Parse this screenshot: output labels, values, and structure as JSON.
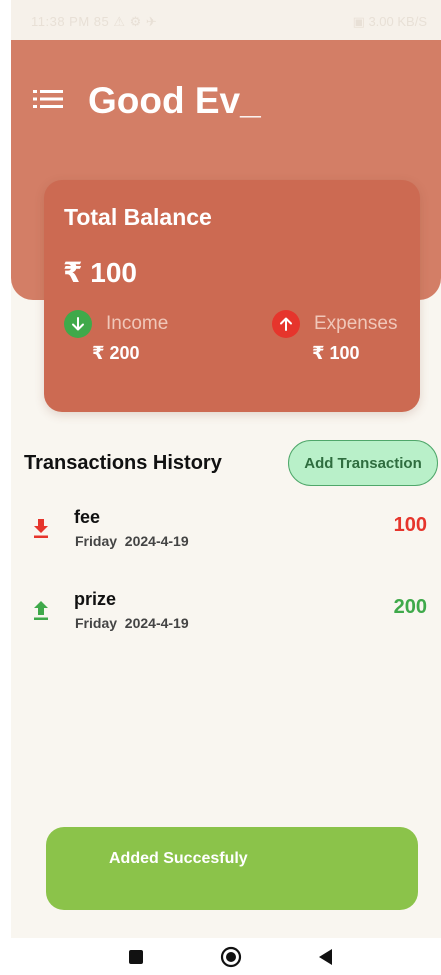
{
  "status_bar": {
    "left": "11:38 PM 85 ⚠ ⚙ ✈",
    "right": "▣ 3.00 KB/S"
  },
  "header": {
    "greeting": "Good Ev_"
  },
  "balance": {
    "label": "Total Balance",
    "value": "₹ 100",
    "income_label": "Income",
    "income_value": "₹ 200",
    "expense_label": "Expenses",
    "expense_value": "₹ 100"
  },
  "transactions": {
    "title": "Transactions History",
    "add_label": "Add Transaction",
    "items": [
      {
        "name": "fee",
        "day": "Friday",
        "date": "2024-4-19",
        "amount": "100",
        "kind": "expense",
        "icon": "download-icon"
      },
      {
        "name": "prize",
        "day": "Friday",
        "date": "2024-4-19",
        "amount": "200",
        "kind": "income",
        "icon": "upload-icon"
      }
    ]
  },
  "toast": {
    "message": "Added Succesfuly"
  },
  "colors": {
    "header": "#d37e66",
    "card": "#cc6a52",
    "income": "#3fa94a",
    "expense": "#e6352c",
    "toast": "#8bc34a",
    "button": "#b9f0c9"
  },
  "navigation": {
    "icons": [
      "square-icon",
      "circle-icon",
      "back-triangle-icon"
    ]
  }
}
